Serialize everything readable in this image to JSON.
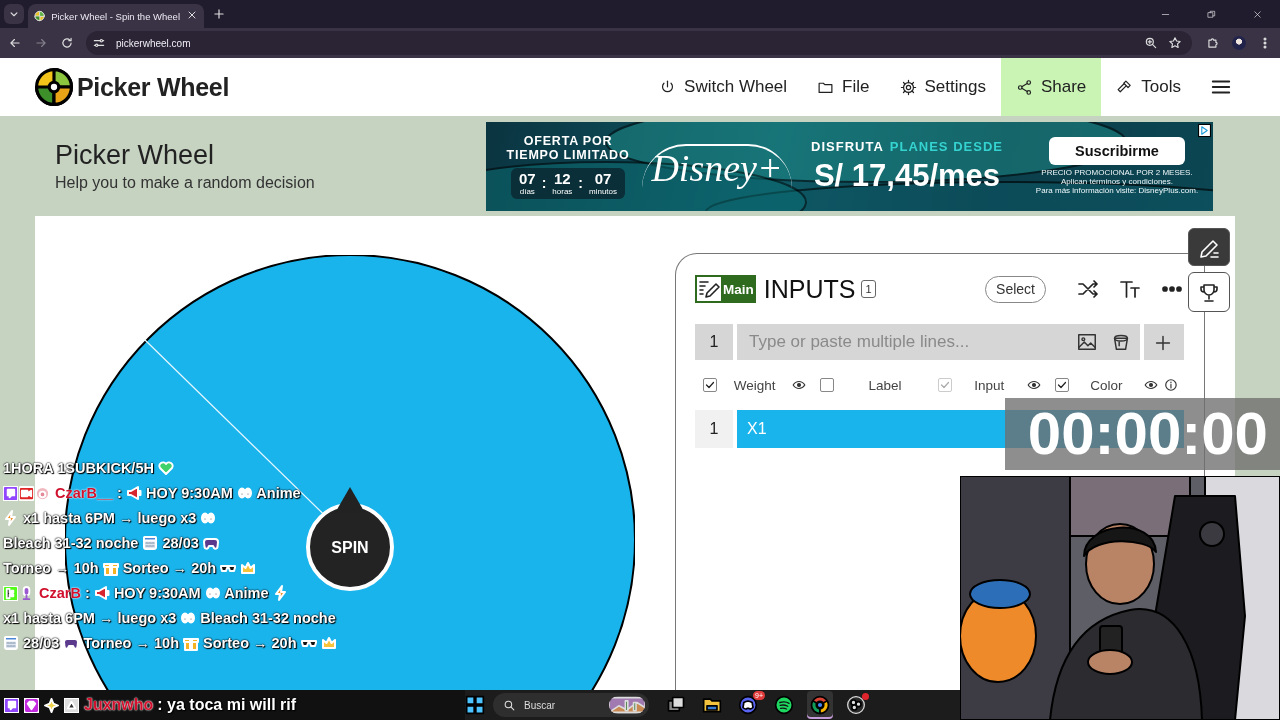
{
  "browser": {
    "tab": {
      "title": "Picker Wheel - Spin the Wheel",
      "selected": true
    },
    "url": "pickerwheel.com"
  },
  "site_header": {
    "logo_text": "Picker Wheel",
    "nav": [
      {
        "label": "Switch Wheel",
        "kind": "switch",
        "highlighted": false
      },
      {
        "label": "File",
        "kind": "file",
        "highlighted": false
      },
      {
        "label": "Settings",
        "kind": "settings",
        "highlighted": false
      },
      {
        "label": "Share",
        "kind": "share",
        "highlighted": true
      },
      {
        "label": "Tools",
        "kind": "tools",
        "highlighted": false
      }
    ]
  },
  "page_title": {
    "title": "Picker Wheel",
    "subtitle": "Help you to make a random decision"
  },
  "ad": {
    "headline": "OFERTA POR TIEMPO LIMITADO",
    "countdown": [
      {
        "value": "07",
        "unit": "días"
      },
      {
        "value": "12",
        "unit": "horas"
      },
      {
        "value": "07",
        "unit": "minutos"
      }
    ],
    "separator": ":",
    "logo": "Disney+",
    "offer_lead": "DISFRUTA",
    "offer_highlight": "PLANES DESDE",
    "price": "S/ 17,45/mes",
    "cta": "Suscribirme",
    "fine_print": [
      "PRECIO PROMOCIONAL POR 2 MESES.",
      "Aplican términos y condiciones.",
      "Para más información visite: DisneyPlus.com."
    ]
  },
  "wheel": {
    "segments": [
      {
        "color": "#1ab4ec"
      }
    ],
    "spin_label": "SPIN"
  },
  "inputs_panel": {
    "tag": "Main",
    "title": "INPUTS",
    "count": "1",
    "select_button": "Select",
    "new_entry": {
      "number": "1",
      "placeholder": "Type or paste multiple lines..."
    },
    "options": [
      {
        "label": "Weight",
        "checked": true,
        "disabled": false,
        "visibility_toggle": true
      },
      {
        "label": "Label",
        "checked": false,
        "disabled": false,
        "visibility_toggle": false
      },
      {
        "label": "Input",
        "checked": true,
        "disabled": true,
        "visibility_toggle": true
      },
      {
        "label": "Color",
        "checked": true,
        "disabled": false,
        "visibility_toggle": true
      }
    ],
    "entries": [
      {
        "number": "1",
        "text": "X1",
        "color": "#1ab4ec"
      }
    ]
  },
  "stream_overlay": {
    "chat": {
      "banner": [
        {
          "kind": "text",
          "text": "1HORA 1SUBKICK/5H"
        },
        {
          "kind": "heart"
        }
      ],
      "messages": [
        {
          "badges": [
            {
              "kind": "twitch"
            },
            {
              "kind": "camera"
            },
            {
              "kind": "avatar"
            }
          ],
          "user": "CzarB__",
          "parts": [
            {
              "kind": "text",
              "text": ":"
            },
            {
              "kind": "megaphone"
            },
            {
              "kind": "text",
              "text": "HOY 9:30AM"
            },
            {
              "kind": "eyes"
            },
            {
              "kind": "text",
              "text": "Anime"
            },
            {
              "kind": "bolt"
            },
            {
              "kind": "text",
              "text": "x1 hasta 6PM → luego x3"
            },
            {
              "kind": "eyes"
            },
            {
              "kind": "text",
              "text": "Bleach 31-32 noche"
            },
            {
              "kind": "calendar"
            },
            {
              "kind": "text",
              "text": "28/03"
            },
            {
              "kind": "gamepad"
            },
            {
              "kind": "text",
              "text": "Torneo → 10h"
            },
            {
              "kind": "gift"
            },
            {
              "kind": "text",
              "text": "Sorteo → 20h"
            },
            {
              "kind": "glasses"
            },
            {
              "kind": "crown"
            }
          ]
        },
        {
          "badges": [
            {
              "kind": "kick"
            },
            {
              "kind": "mic"
            }
          ],
          "user": "CzarB",
          "parts": [
            {
              "kind": "text",
              "text": ":"
            },
            {
              "kind": "megaphone"
            },
            {
              "kind": "text",
              "text": "HOY 9:30AM"
            },
            {
              "kind": "eyes"
            },
            {
              "kind": "text",
              "text": "Anime"
            },
            {
              "kind": "bolt"
            },
            {
              "kind": "text",
              "text": "x1 hasta 6PM → luego x3"
            },
            {
              "kind": "eyes"
            },
            {
              "kind": "text",
              "text": "Bleach 31-32 noche"
            },
            {
              "kind": "calendar"
            },
            {
              "kind": "text",
              "text": "28/03"
            },
            {
              "kind": "gamepad"
            },
            {
              "kind": "text",
              "text": "Torneo → 10h"
            },
            {
              "kind": "gift"
            },
            {
              "kind": "text",
              "text": "Sorteo → 20h"
            },
            {
              "kind": "glasses"
            },
            {
              "kind": "crown"
            }
          ]
        }
      ]
    },
    "latest_message": {
      "badges": [
        {
          "kind": "twitch"
        },
        {
          "kind": "gem"
        },
        {
          "kind": "sparkle"
        },
        {
          "kind": "triangle"
        }
      ],
      "user": "Juxnwho",
      "text": ": ya toca mi will rif"
    },
    "timer": "00:00:00"
  },
  "taskbar": {
    "search_placeholder": "Buscar",
    "apps": [
      {
        "kind": "taskview",
        "active": false
      },
      {
        "kind": "explorer",
        "active": false
      },
      {
        "kind": "discord",
        "active": false,
        "badge": "9+"
      },
      {
        "kind": "spotify",
        "active": false
      },
      {
        "kind": "chrome",
        "active": true
      },
      {
        "kind": "obs",
        "active": false,
        "notification": true
      }
    ]
  }
}
